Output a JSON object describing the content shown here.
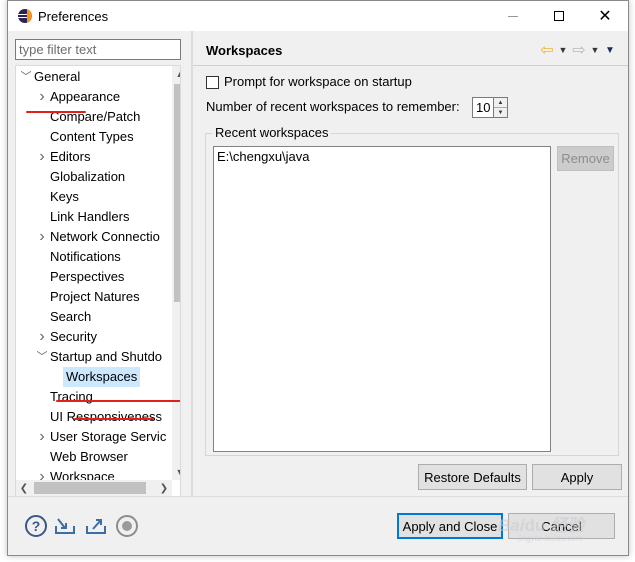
{
  "window": {
    "title": "Preferences",
    "controls": {
      "minimize": "—",
      "close": "✕"
    }
  },
  "sidebar": {
    "filter_placeholder": "type filter text",
    "tree": [
      {
        "label": "General",
        "level": 0,
        "expanded": true
      },
      {
        "label": "Appearance",
        "level": 1,
        "has_children": true
      },
      {
        "label": "Compare/Patch",
        "level": 1
      },
      {
        "label": "Content Types",
        "level": 1
      },
      {
        "label": "Editors",
        "level": 1,
        "has_children": true
      },
      {
        "label": "Globalization",
        "level": 1
      },
      {
        "label": "Keys",
        "level": 1
      },
      {
        "label": "Link Handlers",
        "level": 1
      },
      {
        "label": "Network Connectio",
        "level": 1,
        "has_children": true
      },
      {
        "label": "Notifications",
        "level": 1
      },
      {
        "label": "Perspectives",
        "level": 1
      },
      {
        "label": "Project Natures",
        "level": 1
      },
      {
        "label": "Search",
        "level": 1
      },
      {
        "label": "Security",
        "level": 1,
        "has_children": true
      },
      {
        "label": "Startup and Shutdo",
        "level": 1,
        "expanded": true
      },
      {
        "label": "Workspaces",
        "level": 2,
        "selected": true
      },
      {
        "label": "Tracing",
        "level": 1
      },
      {
        "label": "UI Responsiveness",
        "level": 1
      },
      {
        "label": "User Storage Servic",
        "level": 1,
        "has_children": true
      },
      {
        "label": "Web Browser",
        "level": 1
      },
      {
        "label": "Workspace",
        "level": 1,
        "has_children": true
      }
    ]
  },
  "page": {
    "title": "Workspaces",
    "prompt_checkbox_label": "Prompt for workspace on startup",
    "prompt_checked": false,
    "recent_count_label": "Number of recent workspaces to remember:",
    "recent_count_value": "10",
    "group_label": "Recent workspaces",
    "workspaces": [
      "E:\\chengxu\\java"
    ],
    "remove_label": "Remove",
    "restore_defaults_label": "Restore Defaults",
    "apply_label": "Apply"
  },
  "footer": {
    "apply_close_label": "Apply and Close",
    "cancel_label": "Cancel"
  },
  "colors": {
    "selection": "#cce8ff",
    "annotation_red": "#e0201b",
    "default_button_border": "#0078d7"
  }
}
